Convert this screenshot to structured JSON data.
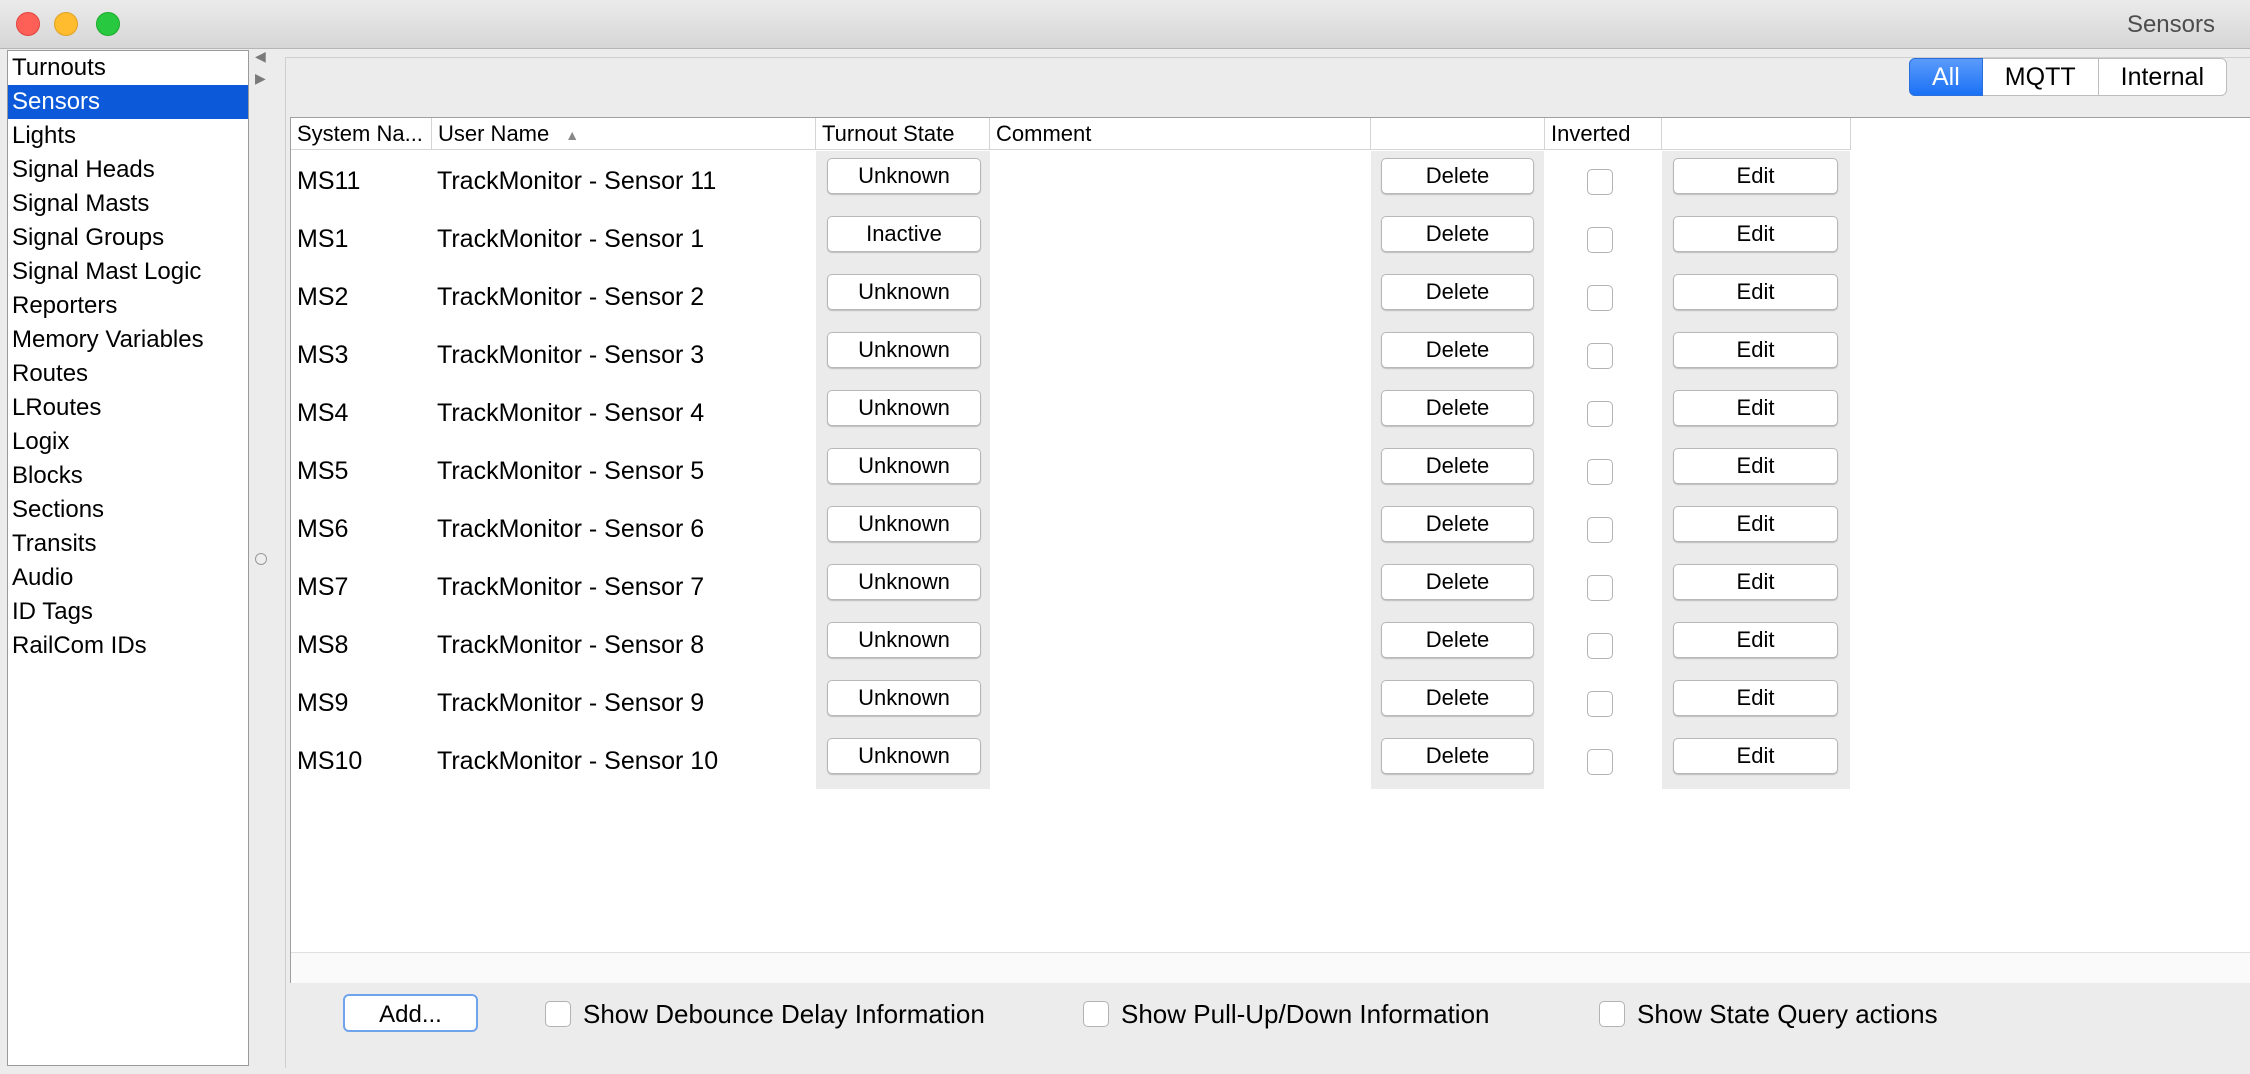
{
  "window": {
    "title": "Sensors"
  },
  "sidebar": {
    "items": [
      "Turnouts",
      "Sensors",
      "Lights",
      "Signal Heads",
      "Signal Masts",
      "Signal Groups",
      "Signal Mast Logic",
      "Reporters",
      "Memory Variables",
      "Routes",
      "LRoutes",
      "Logix",
      "Blocks",
      "Sections",
      "Transits",
      "Audio",
      "ID Tags",
      "RailCom IDs"
    ],
    "selected": "Sensors"
  },
  "tabs": [
    "All",
    "MQTT",
    "Internal"
  ],
  "active_tab": "All",
  "table": {
    "columns": {
      "system_name": "System Na...",
      "user_name": "User Name",
      "state": "Turnout State",
      "comment": "Comment",
      "delete": "",
      "inverted": "Inverted",
      "edit": ""
    },
    "rows": [
      {
        "system": "MS11",
        "user": "TrackMonitor - Sensor 11",
        "state": "Unknown",
        "comment": "",
        "delete": "Delete",
        "inverted": false,
        "edit": "Edit"
      },
      {
        "system": "MS1",
        "user": "TrackMonitor - Sensor 1",
        "state": "Inactive",
        "comment": "",
        "delete": "Delete",
        "inverted": false,
        "edit": "Edit"
      },
      {
        "system": "MS2",
        "user": "TrackMonitor - Sensor 2",
        "state": "Unknown",
        "comment": "",
        "delete": "Delete",
        "inverted": false,
        "edit": "Edit"
      },
      {
        "system": "MS3",
        "user": "TrackMonitor - Sensor 3",
        "state": "Unknown",
        "comment": "",
        "delete": "Delete",
        "inverted": false,
        "edit": "Edit"
      },
      {
        "system": "MS4",
        "user": "TrackMonitor - Sensor 4",
        "state": "Unknown",
        "comment": "",
        "delete": "Delete",
        "inverted": false,
        "edit": "Edit"
      },
      {
        "system": "MS5",
        "user": "TrackMonitor - Sensor 5",
        "state": "Unknown",
        "comment": "",
        "delete": "Delete",
        "inverted": false,
        "edit": "Edit"
      },
      {
        "system": "MS6",
        "user": "TrackMonitor - Sensor 6",
        "state": "Unknown",
        "comment": "",
        "delete": "Delete",
        "inverted": false,
        "edit": "Edit"
      },
      {
        "system": "MS7",
        "user": "TrackMonitor - Sensor 7",
        "state": "Unknown",
        "comment": "",
        "delete": "Delete",
        "inverted": false,
        "edit": "Edit"
      },
      {
        "system": "MS8",
        "user": "TrackMonitor - Sensor 8",
        "state": "Unknown",
        "comment": "",
        "delete": "Delete",
        "inverted": false,
        "edit": "Edit"
      },
      {
        "system": "MS9",
        "user": "TrackMonitor - Sensor 9",
        "state": "Unknown",
        "comment": "",
        "delete": "Delete",
        "inverted": false,
        "edit": "Edit"
      },
      {
        "system": "MS10",
        "user": "TrackMonitor - Sensor 10",
        "state": "Unknown",
        "comment": "",
        "delete": "Delete",
        "inverted": false,
        "edit": "Edit"
      }
    ]
  },
  "bottom": {
    "add_label": "Add...",
    "options": [
      "Show Debounce Delay Information",
      "Show Pull-Up/Down Information",
      "Show State Query actions"
    ]
  },
  "icons": {
    "close": "close-icon",
    "minimize": "minimize-icon",
    "maximize": "maximize-icon",
    "sort": "sort-ascending-icon",
    "collapse_left": "arrow-left-icon",
    "expand_right": "arrow-right-icon"
  },
  "colors": {
    "accent": "#0c5ad9",
    "tab_active": "#1a71f5",
    "close": "#fe5f57",
    "minimize": "#febc2e",
    "maximize": "#28c840"
  }
}
